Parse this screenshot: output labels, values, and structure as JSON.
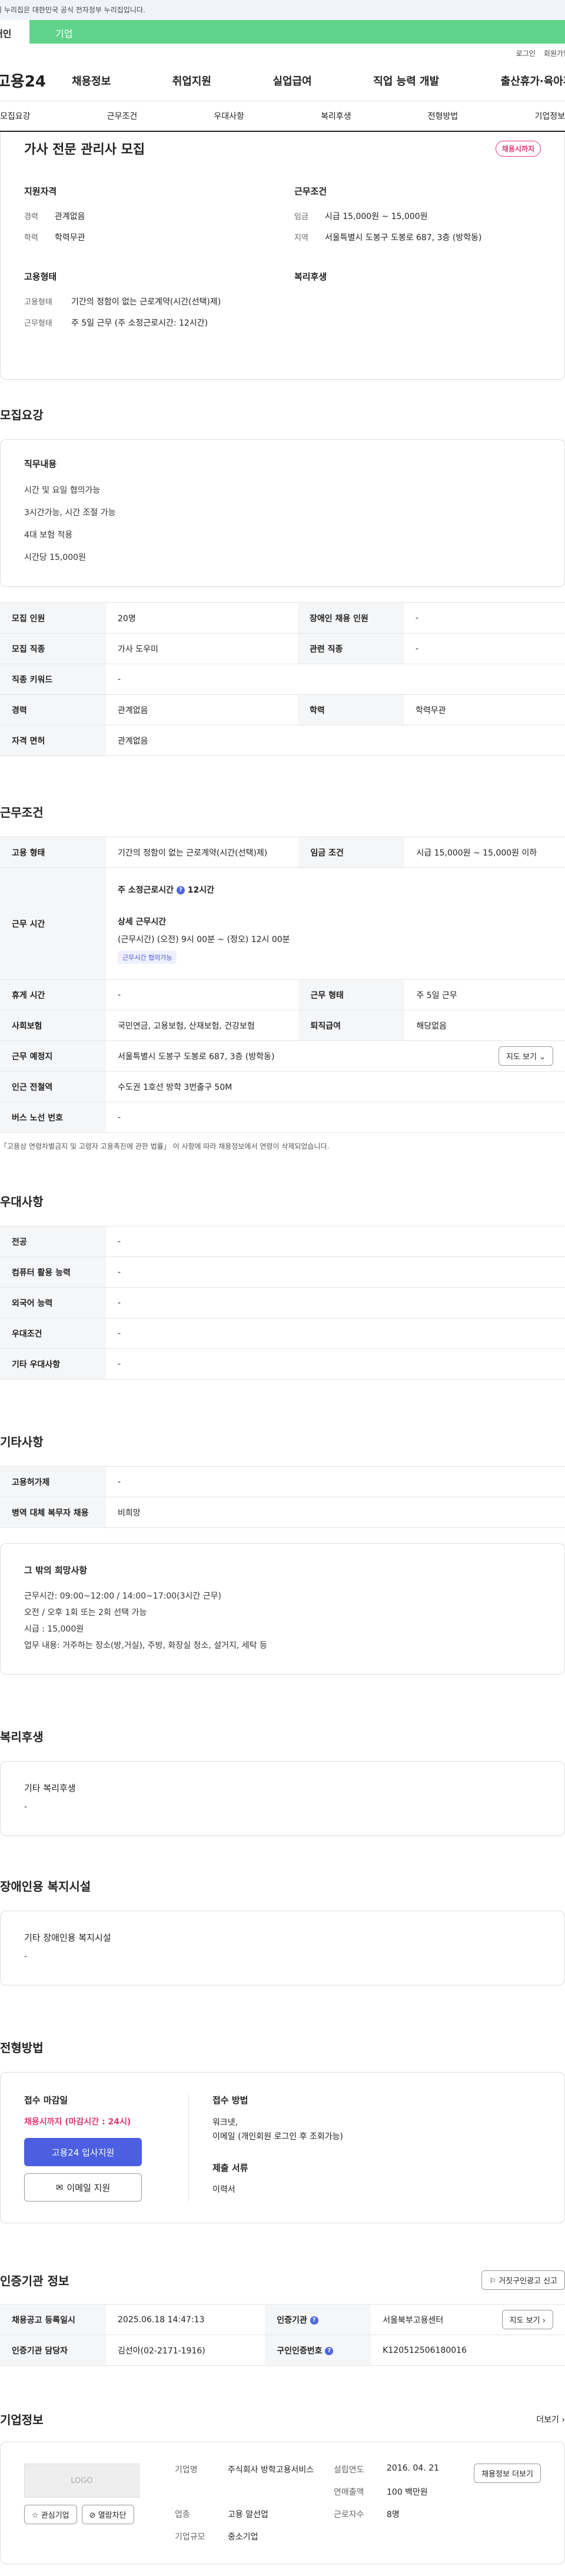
{
  "topbar": {
    "text": "이 누리집은 대한민국 공식 전자정부 누리집입니다."
  },
  "tabs": {
    "personal": "개인",
    "company": "기업"
  },
  "util": {
    "login": "로그인",
    "join": "회원가입"
  },
  "gnb": {
    "logo": "고용24",
    "items": [
      "채용정보",
      "취업지원",
      "실업급여",
      "직업 능력 개발",
      "출산휴가·육아휴직"
    ]
  },
  "subnav": [
    "모집요강",
    "근무조건",
    "우대사항",
    "복리후생",
    "전형방법",
    "기업정보"
  ],
  "job": {
    "title": "가사 전문 관리사 모집",
    "badge": "채용시까지",
    "qual": {
      "head": "지원자격",
      "rows": [
        {
          "k": "경력",
          "v": "관계없음"
        },
        {
          "k": "학력",
          "v": "학력무관"
        }
      ]
    },
    "cond": {
      "head": "근무조건",
      "rows": [
        {
          "k": "임금",
          "v": "시급 15,000원 ~ 15,000원"
        },
        {
          "k": "지역",
          "v": "서울특별시 도봉구 도봉로 687, 3층 (방학동)"
        }
      ]
    },
    "emp": {
      "head": "고용형태",
      "rows": [
        {
          "k": "고용형태",
          "v": "기간의 정함이 없는 근로계약(시간(선택)제)"
        },
        {
          "k": "근무형태",
          "v": "주 5일 근무 (주 소정근로시간: 12시간)"
        }
      ]
    },
    "welfare": {
      "head": "복리후생"
    }
  },
  "recruit": {
    "title": "모집요강",
    "duty_head": "직무내용",
    "duty_lines": [
      "시간 및 요일 협의가능",
      "3시간가능, 시간 조절 가능",
      "4대 보험 적용",
      "시간당 15,000원"
    ],
    "table": [
      [
        {
          "k": "모집 인원",
          "v": "20명"
        },
        {
          "k": "장애인 채용 인원",
          "v": "-"
        }
      ],
      [
        {
          "k": "모집 직종",
          "v": "가사 도우미"
        },
        {
          "k": "관련 직종",
          "v": "-"
        }
      ],
      [
        {
          "k": "직종 키워드",
          "v": "-"
        }
      ],
      [
        {
          "k": "경력",
          "v": "관계없음"
        },
        {
          "k": "학력",
          "v": "학력무관"
        }
      ],
      [
        {
          "k": "자격 면허",
          "v": "관계없음"
        }
      ]
    ]
  },
  "work": {
    "title": "근무조건",
    "row1": {
      "k1": "고용 형태",
      "v1": "기간의 정함이 없는 근로계약(시간(선택)제)",
      "k2": "임금 조건",
      "v2": "시급 15,000원 ~ 15,000원 이하"
    },
    "hours": {
      "k": "근무 시간",
      "weekly_label": "주 소정근로시간",
      "weekly_value": "12시간",
      "detail_head": "상세 근무시간",
      "detail": "(근무시간) (오전) 9시 00분 ~ (정오) 12시 00분",
      "chip": "근무시간 협의가능"
    },
    "row3": {
      "k1": "휴게 시간",
      "v1": "-",
      "k2": "근무 형태",
      "v2": "주 5일 근무"
    },
    "row4": {
      "k1": "사회보험",
      "v1": "국민연금, 고용보험, 산재보험, 건강보험",
      "k2": "퇴직급여",
      "v2": "해당없음"
    },
    "row5": {
      "k": "근무 예정지",
      "v": "서울특별시 도봉구 도봉로 687, 3층 (방학동)",
      "btn": "지도 보기"
    },
    "row6": {
      "k": "인근 전철역",
      "v": "수도권 1호선 방학 3번출구 50M"
    },
    "row7": {
      "k": "버스 노선 번호",
      "v": "-"
    },
    "note": "「고용상 연령차별금지 및 고령자 고용촉진에 관한 법률」 이 사항에 따라 채용정보에서 연령이 삭제되었습니다."
  },
  "pref": {
    "title": "우대사항",
    "rows": [
      {
        "k": "전공",
        "v": "-"
      },
      {
        "k": "컴퓨터 활용 능력",
        "v": "-"
      },
      {
        "k": "외국어 능력",
        "v": "-"
      },
      {
        "k": "우대조건",
        "v": "-"
      },
      {
        "k": "기타 우대사항",
        "v": "-"
      }
    ]
  },
  "etc": {
    "title": "기타사항",
    "rows": [
      {
        "k": "고용허가제",
        "v": "-"
      },
      {
        "k": "병역 대체 복무자 채용",
        "v": "비희망"
      }
    ],
    "other_head": "그 밖의 희망사항",
    "other_lines": [
      "근무시간: 09:00~12:00 / 14:00~17:00(3시간 근무)",
      "오전 / 오후 1회 또는 2회 선택 가능",
      "시급 : 15,000원",
      "업무 내용: 거주하는 장소(방,거실), 주방, 화장실 청소, 설거지, 세탁 등"
    ]
  },
  "benefit": {
    "title": "복리후생",
    "head": "기타 복리후생",
    "value": "-"
  },
  "disability": {
    "title": "장애인용 복지시설",
    "head": "기타 장애인용 복지시설",
    "value": "-"
  },
  "apply": {
    "title": "전형방법",
    "deadline_head": "접수 마감일",
    "deadline": "채용시까지 (마감시간 : 24시)",
    "btn_apply": "고용24 입사지원",
    "btn_email": "이메일 지원",
    "method_head": "접수 방법",
    "method_lines": [
      "워크넷,",
      "이메일 (개인회원 로그인 후 조회가능)"
    ],
    "docs_head": "제출 서류",
    "docs": "이력서"
  },
  "cert": {
    "title": "인증기관 정보",
    "report_btn": "거짓구인광고 신고",
    "row1": {
      "k1": "채용공고 등록일시",
      "v1": "2025.06.18 14:47:13",
      "k2": "인증기관",
      "v2": "서울북부고용센터",
      "btn": "지도 보기"
    },
    "row2": {
      "k1": "인증기관 담당자",
      "v1": "김선아(02-2171-1916)",
      "k2": "구인인증번호",
      "v2": "K120512506180016"
    }
  },
  "company": {
    "title": "기업정보",
    "more": "더보기",
    "logo": "LOGO",
    "btn_fav": "관심기업",
    "btn_block": "열람차단",
    "fields": [
      {
        "k": "기업명",
        "v": "주식회사 방학고용서비스"
      },
      {
        "k": "설립연도",
        "v": "2016. 04. 21"
      },
      {
        "k": "연매출액",
        "v": "100 백만원"
      },
      {
        "k": "업종",
        "v": "고용 알선업"
      },
      {
        "k": "근로자수",
        "v": "8명"
      },
      {
        "k": "기업규모",
        "v": "중소기업"
      }
    ],
    "ad_btn": "채용정보 더보기"
  }
}
